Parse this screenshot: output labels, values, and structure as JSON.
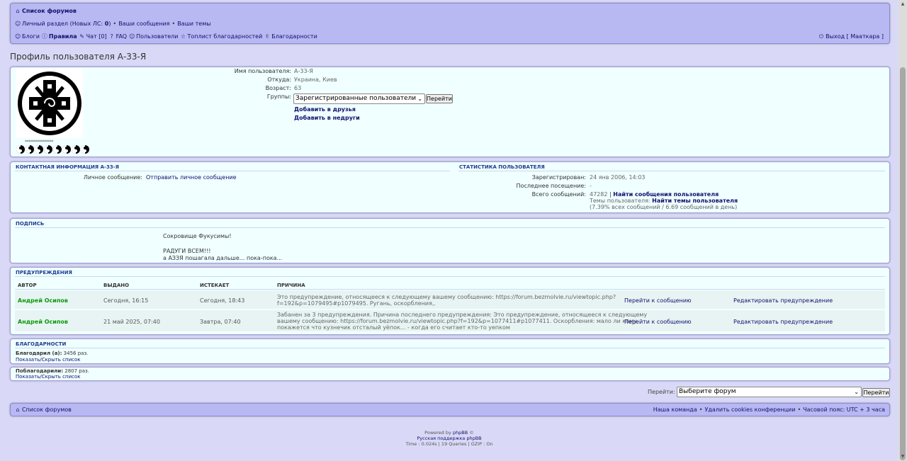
{
  "nav": {
    "forums_index": "Список форумов",
    "personal_section": "Личный раздел (Новых ЛС: ",
    "new_pm_count": "0",
    "personal_section_close": ")",
    "bullet": "•",
    "your_posts": "Ваши сообщения",
    "your_topics": "Ваши темы",
    "blogs": "Блоги",
    "rules": "Правила",
    "chat": "Чат [0]",
    "faq": "FAQ",
    "users": "Пользователи",
    "toplist": "Топлист благодарностей",
    "thanks": "Благодарности",
    "logout": "Выход [ Мааткара ]"
  },
  "page_title": "Профиль пользователя А-33-Я",
  "profile": {
    "username_label": "Имя пользователя:",
    "username": "А-33-Я",
    "from_label": "Откуда:",
    "from": "Украина, Киев",
    "age_label": "Возраст:",
    "age": "63",
    "groups_label": "Группы:",
    "groups_selected": "Зарегистрированные пользователи",
    "go_button": "Перейти",
    "add_friend": "Добавить в друзья",
    "add_foe": "Добавить в недруги",
    "rank_stars": "****************"
  },
  "contact": {
    "header": "КОНТАКТНАЯ ИНФОРМАЦИЯ А-33-Я",
    "pm_label": "Личное сообщение:",
    "pm_link": "Отправить личное сообщение"
  },
  "stats": {
    "header": "СТАТИСТИКА ПОЛЬЗОВАТЕЛЯ",
    "registered_label": "Зарегистрирован:",
    "registered": "24 янв 2006, 14:03",
    "last_visit_label": "Последнее посещение:",
    "last_visit": "-",
    "total_posts_label": "Всего сообщений:",
    "total_posts": "47282",
    "pipe": "|",
    "find_posts": "Найти сообщения пользователя",
    "topics_label": "Темы пользователя:",
    "find_topics": "Найти темы пользователя",
    "percent": "(7.39% всех сообщений / 6.69 сообщений в день)"
  },
  "signature": {
    "header": "ПОДПИСЬ",
    "line1": "Сокровище Фукусимы!",
    "line2": "РАДУГИ ВСЕМ!!!",
    "line3": "а АЗЗЯ пошагала дальше... пока-пока..."
  },
  "warnings": {
    "header": "ПРЕДУПРЕЖДЕНИЯ",
    "col_author": "АВТОР",
    "col_issued": "ВЫДАНО",
    "col_expires": "ИСТЕКАЕТ",
    "col_reason": "ПРИЧИНА",
    "rows": [
      {
        "author": "Андрей Осипов",
        "issued": "Сегодня, 16:15",
        "expires": "Сегодня, 18:43",
        "reason_1": "Это предупреждение, относящееся к следующему вашему сообщению: https://forum.bezmolvie.ru/viewtopic.php?",
        "reason_2": "f=192&p=1079495#p1079495. Ругань, оскорбления,.",
        "reason_3": "",
        "goto": "Перейти к сообщению",
        "edit": "Редактировать предупреждение"
      },
      {
        "author": "Андрей Осипов",
        "issued": "21 май 2025, 07:40",
        "expires": "Завтра, 07:40",
        "reason_1": "Забанен за 3 предупреждения. Причина последнего предупреждения: Это предупреждение, относящееся к следующему",
        "reason_2": "вашему сообщению: https://forum.bezmolvie.ru/viewtopic.php?f=192&p=1077411#p1077411. Оскорбления: мало ли кому",
        "reason_3": "покажется что кузнечик отсталый уёпок... - когда его считает кто-то уепком",
        "goto": "Перейти к сообщению",
        "edit": "Редактировать предупреждение"
      }
    ]
  },
  "thanks": {
    "header": "БЛАГОДАРНОСТИ",
    "gave_label": "Благодарил (а):",
    "gave_value": "3456 раз.",
    "gave_toggle": "Показать/Скрыть список",
    "got_label": "Поблагодарили:",
    "got_value": "2807 раз.",
    "got_toggle": "Показать/Скрыть список"
  },
  "jump": {
    "label": "Перейти:",
    "selected": "Выберите форум",
    "button": "Перейти"
  },
  "footer": {
    "forums_index": "Список форумов",
    "team": "Наша команда",
    "bullet": "•",
    "delete_cookies": "Удалить cookies конференции",
    "timezone": "Часовой пояс: UTC + 3 часа",
    "powered_by": "Powered by",
    "phpbb": "phpBB",
    "copyright": "©",
    "russian_support": "Русская поддержка phpBB",
    "stats": "Time : 0.024s | 19 Queries | GZIP : On"
  }
}
